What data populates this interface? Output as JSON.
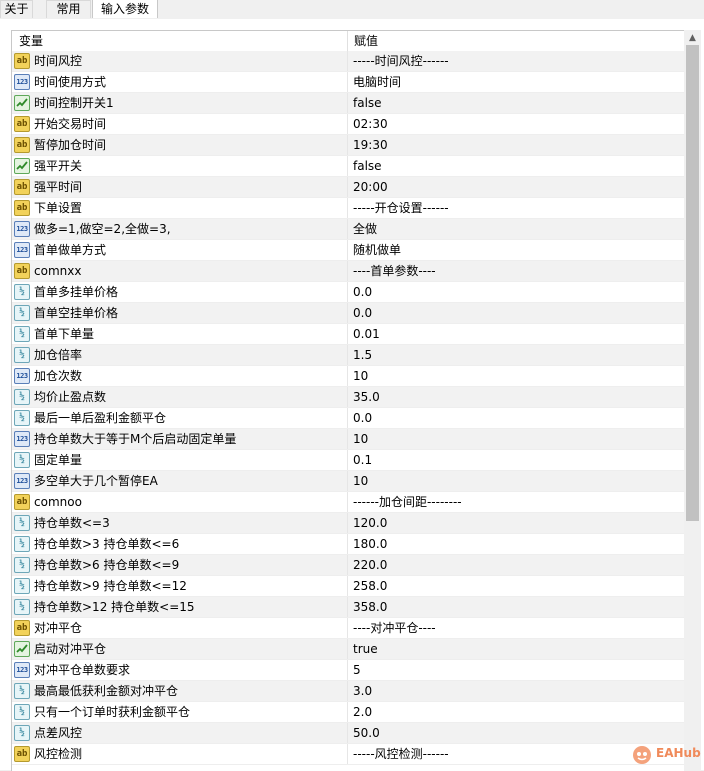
{
  "tabs": [
    {
      "label": "关于",
      "active": false
    },
    {
      "label": "常用",
      "active": false
    },
    {
      "label": "输入参数",
      "active": true
    }
  ],
  "columns": {
    "name": "变量",
    "value": "赋值"
  },
  "rows": [
    {
      "icon": "ab",
      "name": "时间风控",
      "value": "-----时间风控------"
    },
    {
      "icon": "int",
      "name": "时间使用方式",
      "value": "电脑时间"
    },
    {
      "icon": "bool",
      "name": "时间控制开关1",
      "value": "false"
    },
    {
      "icon": "ab",
      "name": "开始交易时间",
      "value": "02:30"
    },
    {
      "icon": "ab",
      "name": "暂停加仓时间",
      "value": "19:30"
    },
    {
      "icon": "bool",
      "name": "强平开关",
      "value": "false"
    },
    {
      "icon": "ab",
      "name": "强平时间",
      "value": "20:00"
    },
    {
      "icon": "ab",
      "name": "下单设置",
      "value": "-----开仓设置------"
    },
    {
      "icon": "int",
      "name": "做多=1,做空=2,全做=3,",
      "value": "全做"
    },
    {
      "icon": "int",
      "name": "首单做单方式",
      "value": "随机做单"
    },
    {
      "icon": "ab",
      "name": "comnxx",
      "value": "----首单参数----"
    },
    {
      "icon": "dbl",
      "name": "首单多挂单价格",
      "value": "0.0"
    },
    {
      "icon": "dbl",
      "name": "首单空挂单价格",
      "value": "0.0"
    },
    {
      "icon": "dbl",
      "name": "首单下单量",
      "value": "0.01"
    },
    {
      "icon": "dbl",
      "name": "加仓倍率",
      "value": "1.5"
    },
    {
      "icon": "int",
      "name": "加仓次数",
      "value": "10"
    },
    {
      "icon": "dbl",
      "name": "均价止盈点数",
      "value": "35.0"
    },
    {
      "icon": "dbl",
      "name": "最后一单后盈利金额平仓",
      "value": "0.0"
    },
    {
      "icon": "int",
      "name": "持仓单数大于等于M个后启动固定单量",
      "value": "10"
    },
    {
      "icon": "dbl",
      "name": "固定单量",
      "value": "0.1"
    },
    {
      "icon": "int",
      "name": "多空单大于几个暂停EA",
      "value": "10"
    },
    {
      "icon": "ab",
      "name": "comnoo",
      "value": "------加仓间距--------"
    },
    {
      "icon": "dbl",
      "name": "持仓单数<=3",
      "value": "120.0"
    },
    {
      "icon": "dbl",
      "name": "持仓单数>3   持仓单数<=6",
      "value": "180.0"
    },
    {
      "icon": "dbl",
      "name": "持仓单数>6   持仓单数<=9",
      "value": "220.0"
    },
    {
      "icon": "dbl",
      "name": "持仓单数>9   持仓单数<=12",
      "value": "258.0"
    },
    {
      "icon": "dbl",
      "name": "持仓单数>12  持仓单数<=15",
      "value": "358.0"
    },
    {
      "icon": "ab",
      "name": "对冲平仓",
      "value": "----对冲平仓----"
    },
    {
      "icon": "bool",
      "name": "启动对冲平仓",
      "value": "true"
    },
    {
      "icon": "int",
      "name": "对冲平仓单数要求",
      "value": "5"
    },
    {
      "icon": "dbl",
      "name": "最高最低获利金额对冲平仓",
      "value": "3.0"
    },
    {
      "icon": "dbl",
      "name": "只有一个订单时获利金额平仓",
      "value": "2.0"
    },
    {
      "icon": "dbl",
      "name": "点差风控",
      "value": "50.0"
    },
    {
      "icon": "ab",
      "name": "风控检测",
      "value": "-----风控检测------"
    }
  ],
  "icon_glyphs": {
    "ab": "ab",
    "int": "123",
    "dbl": "½"
  },
  "watermark": "EAHub"
}
